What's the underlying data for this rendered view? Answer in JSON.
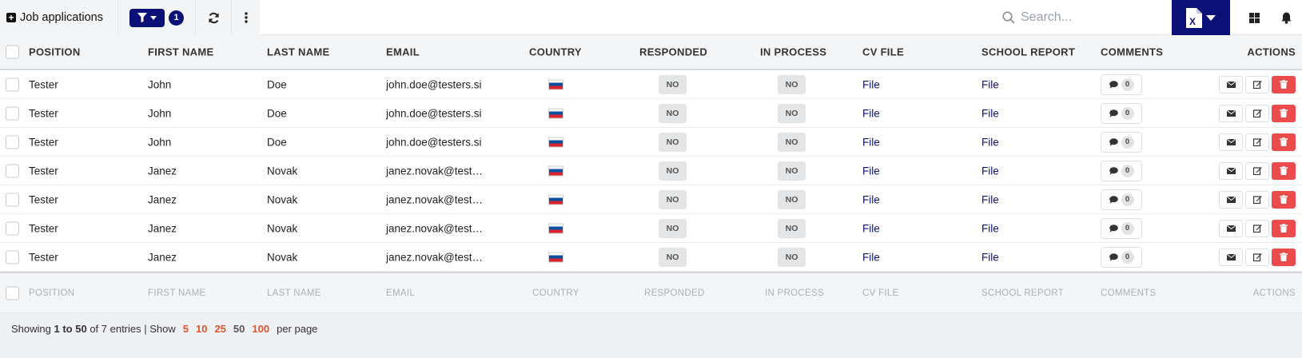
{
  "toolbar": {
    "title": "Job applications",
    "filter_count": "1",
    "search_placeholder": "Search..."
  },
  "columns": {
    "position": "POSITION",
    "first_name": "FIRST NAME",
    "last_name": "LAST NAME",
    "email": "EMAIL",
    "country": "COUNTRY",
    "responded": "RESPONDED",
    "in_process": "IN PROCESS",
    "cv_file": "CV FILE",
    "school_report": "SCHOOL REPORT",
    "comments": "COMMENTS",
    "actions": "ACTIONS"
  },
  "rows": [
    {
      "position": "Tester",
      "first_name": "John",
      "last_name": "Doe",
      "email": "john.doe@testers.si",
      "country": "Slovenia",
      "responded": "NO",
      "in_process": "NO",
      "cv_file": "File",
      "school_report": "File",
      "comments": "0"
    },
    {
      "position": "Tester",
      "first_name": "John",
      "last_name": "Doe",
      "email": "john.doe@testers.si",
      "country": "Slovenia",
      "responded": "NO",
      "in_process": "NO",
      "cv_file": "File",
      "school_report": "File",
      "comments": "0"
    },
    {
      "position": "Tester",
      "first_name": "John",
      "last_name": "Doe",
      "email": "john.doe@testers.si",
      "country": "Slovenia",
      "responded": "NO",
      "in_process": "NO",
      "cv_file": "File",
      "school_report": "File",
      "comments": "0"
    },
    {
      "position": "Tester",
      "first_name": "Janez",
      "last_name": "Novak",
      "email": "janez.novak@test…",
      "country": "Slovenia",
      "responded": "NO",
      "in_process": "NO",
      "cv_file": "File",
      "school_report": "File",
      "comments": "0"
    },
    {
      "position": "Tester",
      "first_name": "Janez",
      "last_name": "Novak",
      "email": "janez.novak@test…",
      "country": "Slovenia",
      "responded": "NO",
      "in_process": "NO",
      "cv_file": "File",
      "school_report": "File",
      "comments": "0"
    },
    {
      "position": "Tester",
      "first_name": "Janez",
      "last_name": "Novak",
      "email": "janez.novak@test…",
      "country": "Slovenia",
      "responded": "NO",
      "in_process": "NO",
      "cv_file": "File",
      "school_report": "File",
      "comments": "0"
    },
    {
      "position": "Tester",
      "first_name": "Janez",
      "last_name": "Novak",
      "email": "janez.novak@test…",
      "country": "Slovenia",
      "responded": "NO",
      "in_process": "NO",
      "cv_file": "File",
      "school_report": "File",
      "comments": "0"
    }
  ],
  "pagination": {
    "showing_prefix": "Showing",
    "range": "1 to 50",
    "of_text": "of 7 entries | Show",
    "page_sizes": [
      "5",
      "10",
      "25",
      "50",
      "100"
    ],
    "active_page_size": "50",
    "per_page": "per page"
  },
  "colors": {
    "primary": "#0c1177",
    "danger": "#ec4b4b",
    "page_size_link": "#e0552b"
  }
}
